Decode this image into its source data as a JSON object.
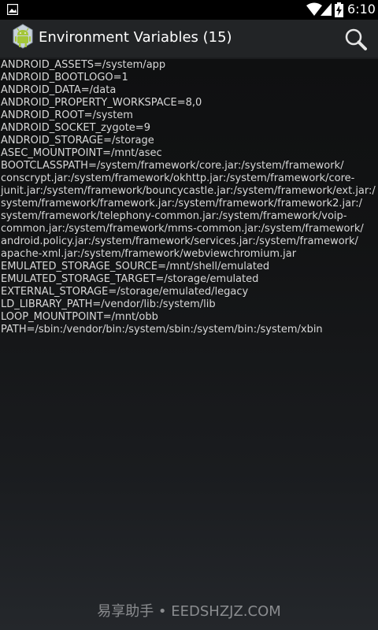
{
  "status_bar": {
    "clock": "6:10",
    "icons": [
      "image-notification-icon",
      "wifi-icon",
      "signal-icon",
      "battery-charging-icon"
    ]
  },
  "action_bar": {
    "icon": "android-app-icon",
    "title": "Environment Variables (15)",
    "action_icon": "search-icon"
  },
  "env_lines": [
    "ANDROID_ASSETS=/system/app",
    "ANDROID_BOOTLOGO=1",
    "ANDROID_DATA=/data",
    "ANDROID_PROPERTY_WORKSPACE=8,0",
    "ANDROID_ROOT=/system",
    "ANDROID_SOCKET_zygote=9",
    "ANDROID_STORAGE=/storage",
    "ASEC_MOUNTPOINT=/mnt/asec",
    "BOOTCLASSPATH=/system/framework/core.jar:/system/framework/",
    "conscrypt.jar:/system/framework/okhttp.jar:/system/framework/core-",
    "junit.jar:/system/framework/bouncycastle.jar:/system/framework/ext.jar:/",
    "system/framework/framework.jar:/system/framework/framework2.jar:/",
    "system/framework/telephony-common.jar:/system/framework/voip-",
    "common.jar:/system/framework/mms-common.jar:/system/framework/",
    "android.policy.jar:/system/framework/services.jar:/system/framework/",
    "apache-xml.jar:/system/framework/webviewchromium.jar",
    "EMULATED_STORAGE_SOURCE=/mnt/shell/emulated",
    "EMULATED_STORAGE_TARGET=/storage/emulated",
    "EXTERNAL_STORAGE=/storage/emulated/legacy",
    "LD_LIBRARY_PATH=/vendor/lib:/system/lib",
    "LOOP_MOUNTPOINT=/mnt/obb",
    "PATH=/sbin:/vendor/bin:/system/sbin:/system/bin:/system/xbin"
  ],
  "watermark": "易享助手 • EEDSHZJZ.COM",
  "colors": {
    "status_bar_bg": "#000000",
    "action_bar_bg": "#222426",
    "text": "#d8d8d8",
    "android_green": "#a4c639"
  }
}
